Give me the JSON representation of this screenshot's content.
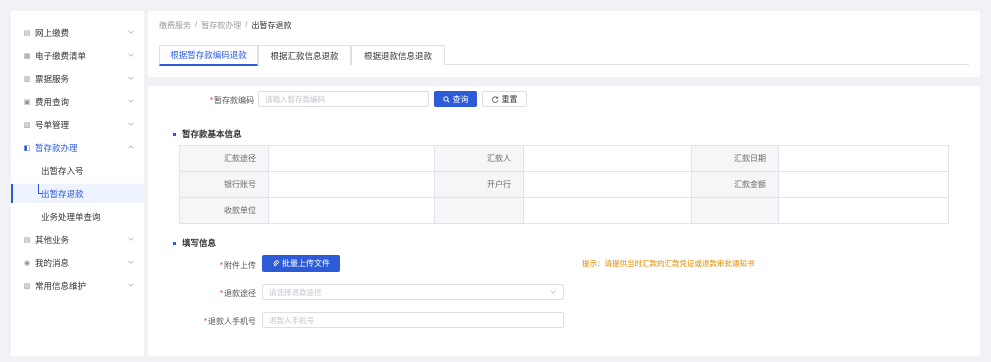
{
  "sidebar": {
    "items": [
      {
        "label": "网上缴费",
        "icon": "payment-icon"
      },
      {
        "label": "电子缴费清单",
        "icon": "list-icon"
      },
      {
        "label": "票据服务",
        "icon": "ticket-icon"
      },
      {
        "label": "费用查询",
        "icon": "query-icon"
      },
      {
        "label": "号单管理",
        "icon": "doc-icon"
      },
      {
        "label": "暂存款办理",
        "icon": "deposit-icon"
      },
      {
        "label": "其他业务",
        "icon": "other-icon"
      },
      {
        "label": "我的消息",
        "icon": "message-icon"
      },
      {
        "label": "常用信息维护",
        "icon": "settings-icon"
      }
    ],
    "subitems": [
      {
        "label": "出暂存入号"
      },
      {
        "label": "出暂存退款"
      },
      {
        "label": "业务处理单查询"
      }
    ]
  },
  "breadcrumb": {
    "items": [
      "缴费服务",
      "暂存款办理",
      "出暂存退款"
    ],
    "sep": "/"
  },
  "tabs": [
    {
      "label": "根据暂存款编码退款"
    },
    {
      "label": "根据汇款信息退款"
    },
    {
      "label": "根据退款信息退款"
    }
  ],
  "search": {
    "label": "暂存款编码",
    "placeholder": "请输入暂存款编码",
    "query_label": "查询",
    "reset_label": "重置"
  },
  "basic_info": {
    "title": "暂存款基本信息",
    "rows": [
      [
        "汇款途径",
        "",
        "汇款人",
        "",
        "汇款日期",
        ""
      ],
      [
        "银行账号",
        "",
        "开户行",
        "",
        "汇款金额",
        ""
      ],
      [
        "收款单位",
        "",
        "",
        "",
        "",
        ""
      ]
    ]
  },
  "fill_info": {
    "title": "填写信息",
    "attachment_label": "附件上传",
    "upload_label": "批量上传文件",
    "hint": "提示：请提供当时汇款的汇款凭证或退款审批通知书",
    "refund_way_label": "退款途径",
    "refund_way_placeholder": "请选择退款途径",
    "phone_label": "退款人手机号",
    "phone_placeholder": "退款人手机号"
  },
  "colors": {
    "accent": "#2d5bd7",
    "required": "#ee3333",
    "hint": "#e08a00"
  }
}
